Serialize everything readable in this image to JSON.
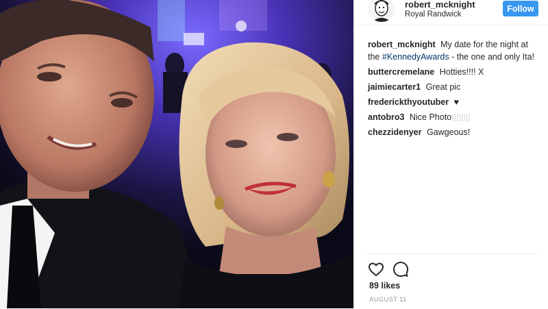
{
  "post": {
    "username": "robert_mcknight",
    "location": "Royal Randwick",
    "follow_label": "Follow",
    "caption": {
      "username": "robert_mcknight",
      "text_before": "My date for the night at the",
      "hashtag": "#KennedyAwards",
      "text_after": "- the one and only Ita!"
    },
    "comments": [
      {
        "username": "buttercremelane",
        "text": "Hotties!!!! X"
      },
      {
        "username": "jaimiecarter1",
        "text": "Great pic"
      },
      {
        "username": "frederickthyoutuber",
        "text": "♥"
      },
      {
        "username": "antobro3",
        "text": "Nice Photo",
        "suffix": "▯▯▯▯"
      },
      {
        "username": "chezzidenyer",
        "text": "Gawgeous!"
      }
    ],
    "likes": "89 likes",
    "date": "AUGUST 11"
  },
  "icons": {
    "like": "heart-outline-icon",
    "comment": "speech-bubble-icon"
  },
  "colors": {
    "follow_button": "#3897f0",
    "hashtag": "#003569",
    "stage_light": "#5a3fd6"
  }
}
